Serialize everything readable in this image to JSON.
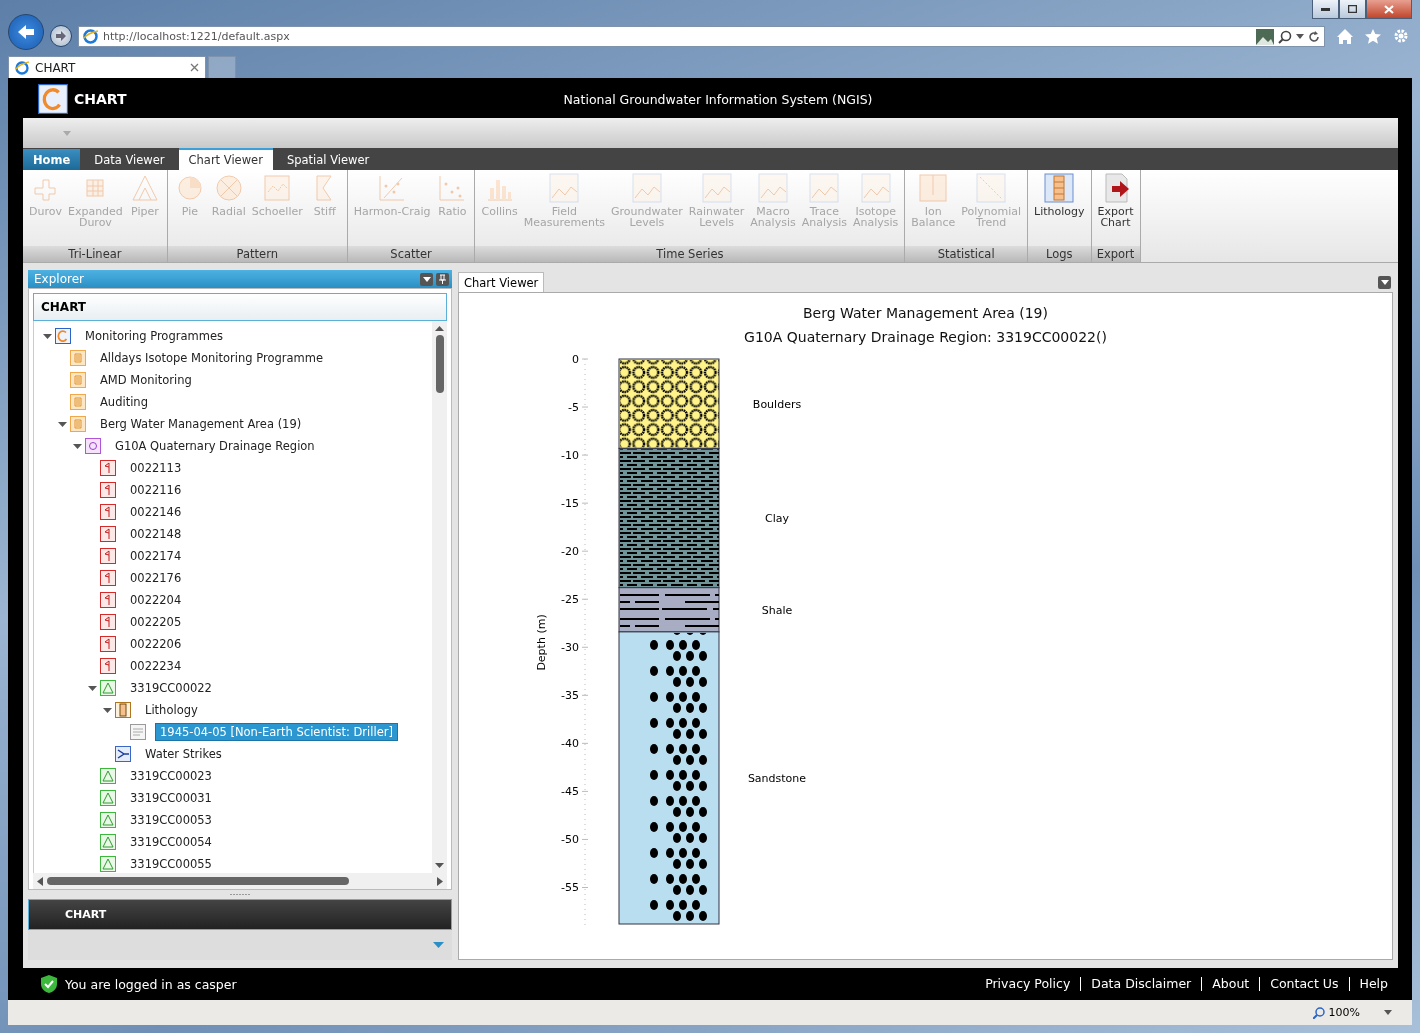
{
  "browser": {
    "address": "http://localhost:1221/default.aspx",
    "tab": "CHART",
    "zoom": "100%"
  },
  "header": {
    "app_name": "CHART",
    "system_title": "National Groundwater Information System (NGIS)"
  },
  "tabs": [
    {
      "label": "Home",
      "kind": "app-menu",
      "selected": false
    },
    {
      "label": "Data Viewer",
      "kind": "tab",
      "selected": false
    },
    {
      "label": "Chart Viewer",
      "kind": "tab",
      "selected": true
    },
    {
      "label": "Spatial Viewer",
      "kind": "tab",
      "selected": false
    }
  ],
  "ribbon": [
    {
      "label": "Tri-Linear",
      "buttons": [
        {
          "label": "Durov",
          "enabled": false
        },
        {
          "label": "Expanded\nDurov",
          "enabled": false
        },
        {
          "label": "Piper",
          "enabled": false
        }
      ]
    },
    {
      "label": "Pattern",
      "buttons": [
        {
          "label": "Pie",
          "enabled": false
        },
        {
          "label": "Radial",
          "enabled": false
        },
        {
          "label": "Schoeller",
          "enabled": false
        },
        {
          "label": "Stiff",
          "enabled": false
        }
      ]
    },
    {
      "label": "Scatter",
      "buttons": [
        {
          "label": "Harmon-Craig",
          "enabled": false
        },
        {
          "label": "Ratio",
          "enabled": false
        }
      ]
    },
    {
      "label": "Time Series",
      "buttons": [
        {
          "label": "Collins",
          "enabled": false
        },
        {
          "label": "Field\nMeasurements",
          "enabled": false
        },
        {
          "label": "Groundwater\nLevels",
          "enabled": false
        },
        {
          "label": "Rainwater\nLevels",
          "enabled": false
        },
        {
          "label": "Macro\nAnalysis",
          "enabled": false
        },
        {
          "label": "Trace\nAnalysis",
          "enabled": false
        },
        {
          "label": "Isotope\nAnalysis",
          "enabled": false
        }
      ]
    },
    {
      "label": "Statistical",
      "buttons": [
        {
          "label": "Ion\nBalance",
          "enabled": false
        },
        {
          "label": "Polynomial\nTrend",
          "enabled": false
        }
      ]
    },
    {
      "label": "Logs",
      "buttons": [
        {
          "label": "Lithology",
          "enabled": true
        }
      ]
    },
    {
      "label": "Export",
      "buttons": [
        {
          "label": "Export\nChart",
          "enabled": true
        }
      ]
    }
  ],
  "explorer": {
    "title": "Explorer",
    "header": "CHART",
    "footer": "CHART",
    "tree": [
      {
        "label": "Monitoring Programmes",
        "kind": "root",
        "expanded": true,
        "selected": false,
        "children": [
          {
            "label": "Alldays Isotope Monitoring Programme",
            "kind": "programme",
            "selected": false
          },
          {
            "label": "AMD Monitoring",
            "kind": "programme",
            "selected": false
          },
          {
            "label": "Auditing",
            "kind": "programme",
            "selected": false
          },
          {
            "label": "Berg Water Management Area (19)",
            "kind": "programme",
            "expanded": true,
            "selected": false,
            "children": [
              {
                "label": "G10A Quaternary Drainage Region",
                "kind": "region",
                "expanded": true,
                "selected": false,
                "children": [
                  {
                    "label": "0022113",
                    "kind": "borehole",
                    "selected": false
                  },
                  {
                    "label": "0022116",
                    "kind": "borehole",
                    "selected": false
                  },
                  {
                    "label": "0022146",
                    "kind": "borehole",
                    "selected": false
                  },
                  {
                    "label": "0022148",
                    "kind": "borehole",
                    "selected": false
                  },
                  {
                    "label": "0022174",
                    "kind": "borehole",
                    "selected": false
                  },
                  {
                    "label": "0022176",
                    "kind": "borehole",
                    "selected": false
                  },
                  {
                    "label": "0022204",
                    "kind": "borehole",
                    "selected": false
                  },
                  {
                    "label": "0022205",
                    "kind": "borehole",
                    "selected": false
                  },
                  {
                    "label": "0022206",
                    "kind": "borehole",
                    "selected": false
                  },
                  {
                    "label": "0022234",
                    "kind": "borehole",
                    "selected": false
                  },
                  {
                    "label": "3319CC00022",
                    "kind": "site",
                    "expanded": true,
                    "selected": false,
                    "children": [
                      {
                        "label": "Lithology",
                        "kind": "log-group",
                        "expanded": true,
                        "selected": false,
                        "children": [
                          {
                            "label": "1945-04-05 [Non-Earth Scientist: Driller]",
                            "kind": "log",
                            "selected": true
                          }
                        ]
                      },
                      {
                        "label": "Water Strikes",
                        "kind": "strikes",
                        "selected": false
                      }
                    ]
                  },
                  {
                    "label": "3319CC00023",
                    "kind": "site",
                    "selected": false
                  },
                  {
                    "label": "3319CC00031",
                    "kind": "site",
                    "selected": false
                  },
                  {
                    "label": "3319CC00053",
                    "kind": "site",
                    "selected": false
                  },
                  {
                    "label": "3319CC00054",
                    "kind": "site",
                    "selected": false
                  },
                  {
                    "label": "3319CC00055",
                    "kind": "site",
                    "selected": false
                  }
                ]
              }
            ]
          }
        ]
      }
    ]
  },
  "chart_viewer": {
    "tab": "Chart Viewer",
    "title": "Berg Water Management Area (19)",
    "subtitle": "G10A Quaternary Drainage Region: 3319CC00022()",
    "chart_data": {
      "type": "bar",
      "stacked": true,
      "orientation": "vertical",
      "ylabel": "Depth (m)",
      "ylim": [
        -58.8,
        0
      ],
      "yticks": [
        0,
        -5,
        -10,
        -15,
        -20,
        -25,
        -30,
        -35,
        -40,
        -45,
        -50,
        -55
      ],
      "series": [
        {
          "name": "Boulders",
          "color": "#fff38a",
          "values": [
            -9.3
          ]
        },
        {
          "name": "Clay",
          "color": "#6f9599",
          "values": [
            -14.5
          ]
        },
        {
          "name": "Shale",
          "color": "#a9adc4",
          "values": [
            -4.6
          ]
        },
        {
          "name": "Sandstone",
          "color": "#b9def0",
          "values": [
            -30.4
          ]
        }
      ]
    }
  },
  "footer": {
    "login": "You are logged in as casper",
    "links": [
      "Privacy Policy",
      "Data Disclaimer",
      "About",
      "Contact Us",
      "Help"
    ]
  }
}
